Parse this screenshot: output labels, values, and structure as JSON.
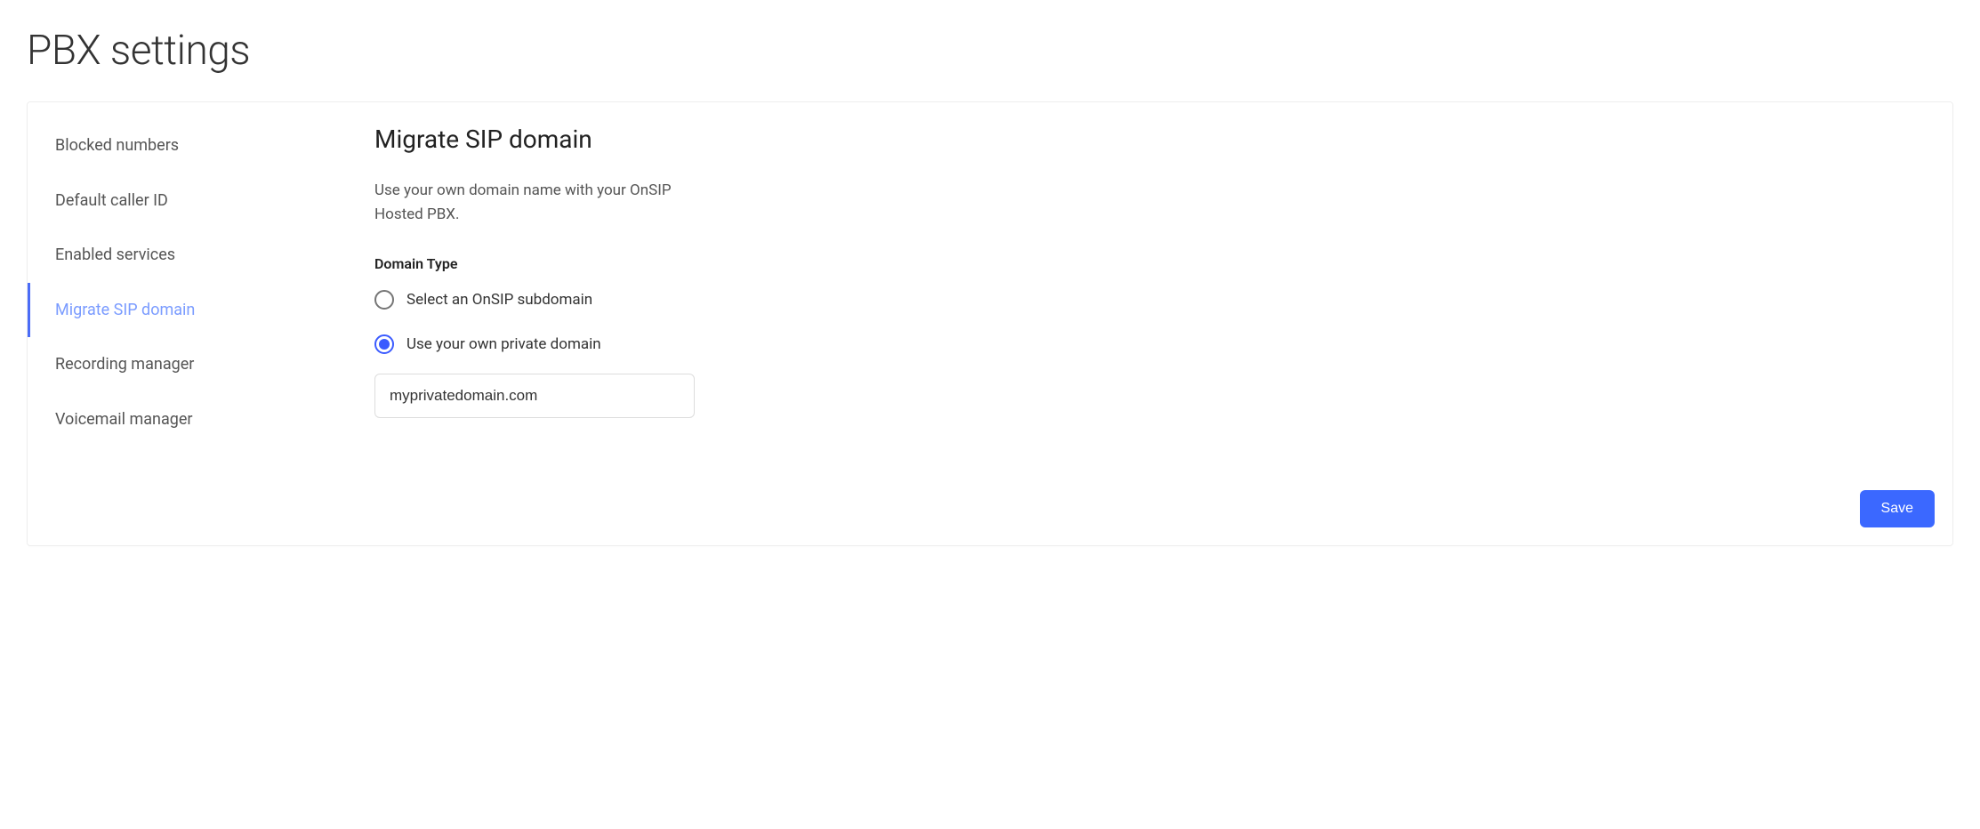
{
  "page_title": "PBX settings",
  "sidebar": {
    "items": [
      {
        "label": "Blocked numbers",
        "active": false
      },
      {
        "label": "Default caller ID",
        "active": false
      },
      {
        "label": "Enabled services",
        "active": false
      },
      {
        "label": "Migrate SIP domain",
        "active": true
      },
      {
        "label": "Recording manager",
        "active": false
      },
      {
        "label": "Voicemail manager",
        "active": false
      }
    ]
  },
  "content": {
    "title": "Migrate SIP domain",
    "description": "Use your own domain name with your OnSIP Hosted PBX.",
    "section_label": "Domain Type",
    "options": [
      {
        "label": "Select an OnSIP subdomain",
        "selected": false
      },
      {
        "label": "Use your own private domain",
        "selected": true
      }
    ],
    "domain_input_value": "myprivatedomain.com"
  },
  "actions": {
    "save_label": "Save"
  }
}
